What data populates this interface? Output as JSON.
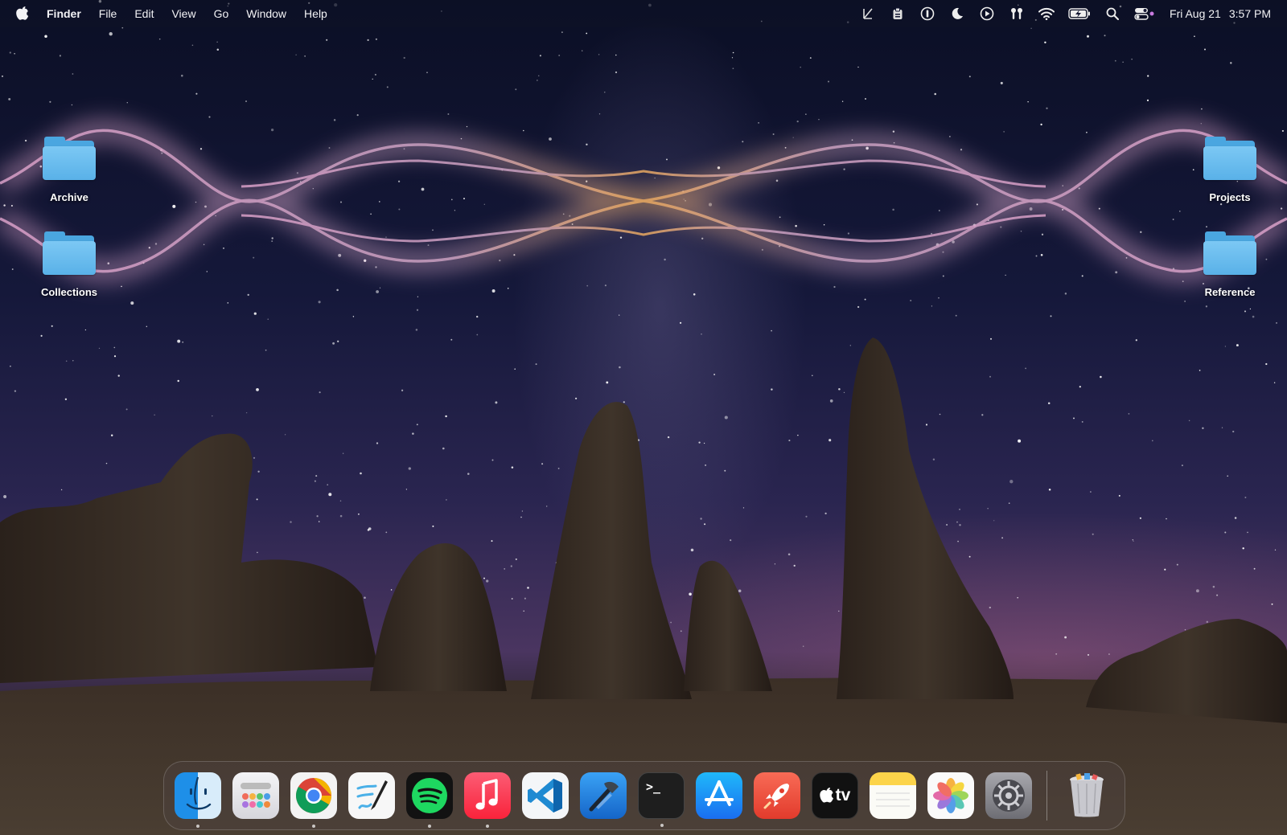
{
  "menubar": {
    "app_name": "Finder",
    "menus": [
      "File",
      "Edit",
      "View",
      "Go",
      "Window",
      "Help"
    ],
    "status_icons": [
      "keystroke-icon",
      "clipboard-icon",
      "password-manager-icon",
      "focus-moon-icon",
      "play-circle-icon",
      "airpods-icon",
      "wifi-icon",
      "battery-charging-icon",
      "spotlight-search-icon",
      "control-center-icon"
    ],
    "date": "Fri Aug 21",
    "time": "3:57 PM"
  },
  "desktop": {
    "icons": [
      {
        "label": "Archive",
        "type": "folder"
      },
      {
        "label": "Collections",
        "type": "folder"
      },
      {
        "label": "Projects",
        "type": "folder"
      },
      {
        "label": "Reference",
        "type": "folder"
      }
    ]
  },
  "dock": {
    "apps": [
      {
        "name": "finder-icon",
        "running": true
      },
      {
        "name": "launchpad-icon",
        "running": false
      },
      {
        "name": "chrome-icon",
        "running": true
      },
      {
        "name": "freeform-icon",
        "running": false
      },
      {
        "name": "spotify-icon",
        "running": true
      },
      {
        "name": "music-icon",
        "running": true
      },
      {
        "name": "vscode-icon",
        "running": false
      },
      {
        "name": "xcode-icon",
        "running": false
      },
      {
        "name": "terminal-icon",
        "running": true
      },
      {
        "name": "app-store-icon",
        "running": false
      },
      {
        "name": "rocket-icon",
        "running": false
      },
      {
        "name": "apple-tv-icon",
        "running": false
      },
      {
        "name": "notes-icon",
        "running": false
      },
      {
        "name": "photos-icon",
        "running": false
      },
      {
        "name": "system-settings-icon",
        "running": false
      }
    ],
    "trash": {
      "name": "trash-icon"
    },
    "terminal_glyph": ">_",
    "tv_label": "tv"
  },
  "colors": {
    "folder_blue": "#5fb4ea",
    "wave_pink": "#d9a0c8",
    "wave_orange": "#e8a860",
    "menubar_bg": "#141733"
  }
}
